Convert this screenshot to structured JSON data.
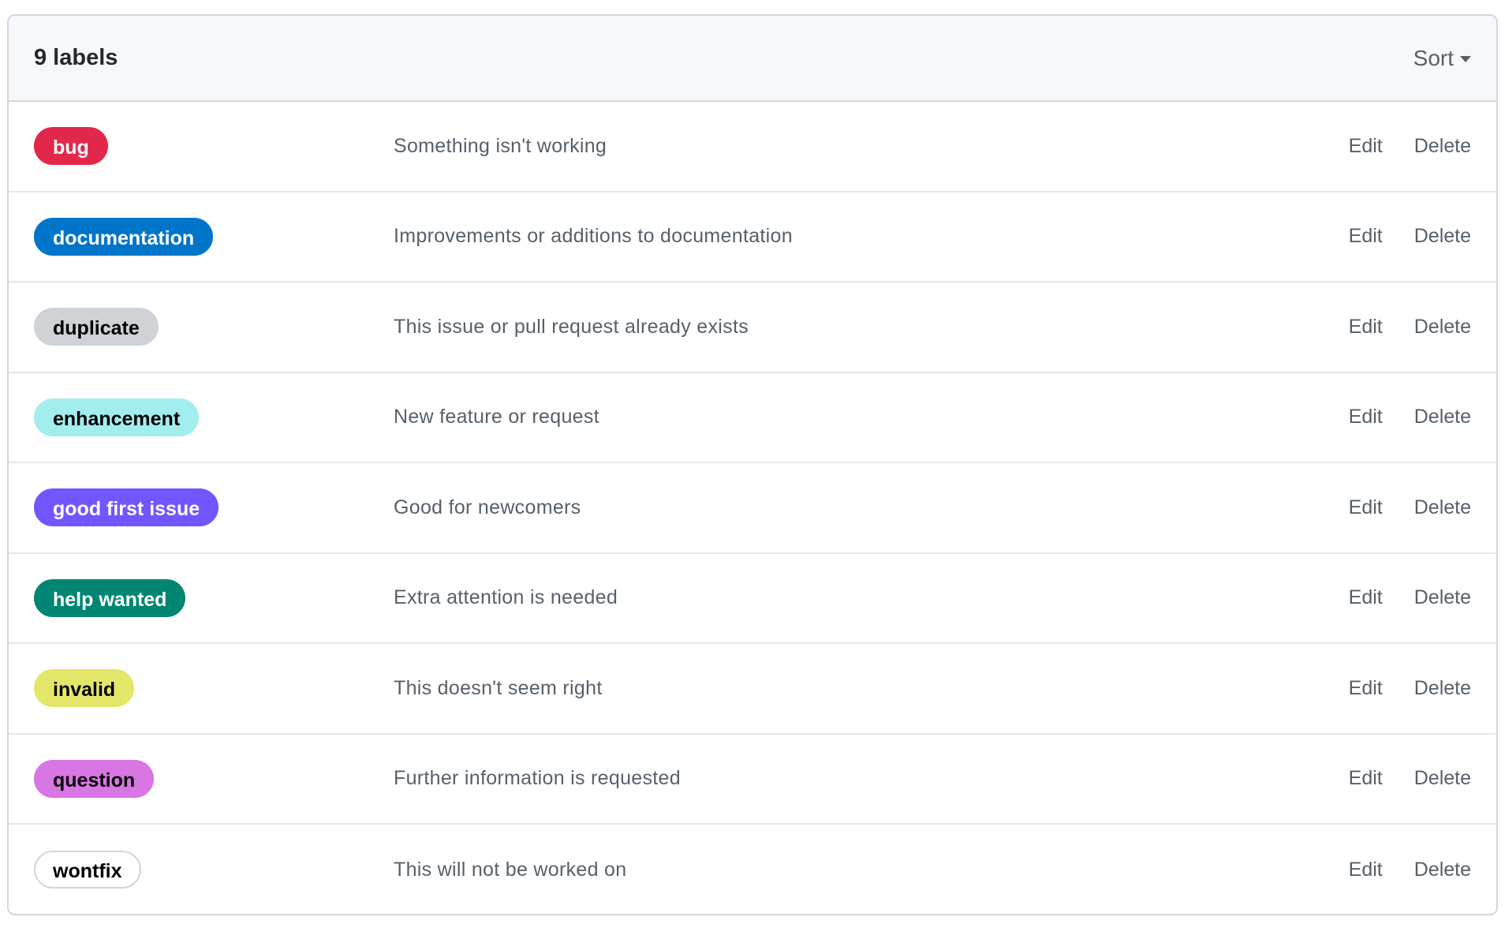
{
  "header": {
    "count_text": "9 labels",
    "sort_label": "Sort",
    "sort_icon": "caret-down-icon"
  },
  "actions": {
    "edit_label": "Edit",
    "delete_label": "Delete"
  },
  "labels": [
    {
      "name": "bug",
      "description": "Something isn't working",
      "bg": "#e2284a",
      "fg": "#ffffff",
      "border": "#e2284a"
    },
    {
      "name": "documentation",
      "description": "Improvements or additions to documentation",
      "bg": "#0075ca",
      "fg": "#ffffff",
      "border": "#0075ca"
    },
    {
      "name": "duplicate",
      "description": "This issue or pull request already exists",
      "bg": "#cfd3d7",
      "fg": "#000000",
      "border": "#cfd3d7"
    },
    {
      "name": "enhancement",
      "description": "New feature or request",
      "bg": "#a2eeef",
      "fg": "#000000",
      "border": "#a2eeef"
    },
    {
      "name": "good first issue",
      "description": "Good for newcomers",
      "bg": "#7057ff",
      "fg": "#ffffff",
      "border": "#7057ff"
    },
    {
      "name": "help wanted",
      "description": "Extra attention is needed",
      "bg": "#008672",
      "fg": "#ffffff",
      "border": "#008672"
    },
    {
      "name": "invalid",
      "description": "This doesn't seem right",
      "bg": "#e4e669",
      "fg": "#000000",
      "border": "#e4e669"
    },
    {
      "name": "question",
      "description": "Further information is requested",
      "bg": "#d876e3",
      "fg": "#000000",
      "border": "#d876e3"
    },
    {
      "name": "wontfix",
      "description": "This will not be worked on",
      "bg": "#ffffff",
      "fg": "#000000",
      "border": "#d0d7de"
    }
  ]
}
